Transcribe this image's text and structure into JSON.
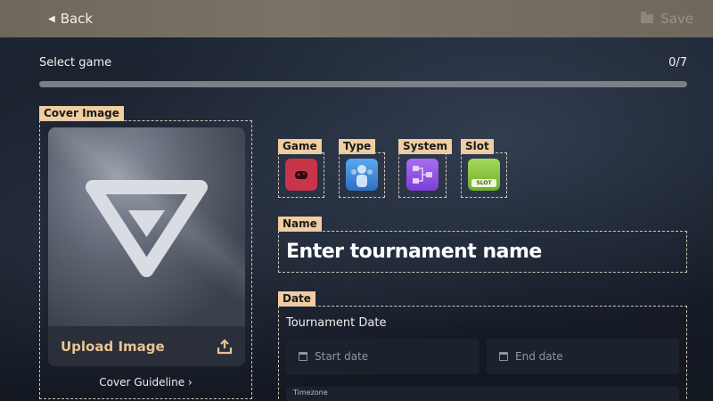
{
  "header": {
    "back_label": "Back",
    "save_label": "Save"
  },
  "progress": {
    "step_label": "Select game",
    "count": "0/7",
    "fraction": 0
  },
  "cover": {
    "tag": "Cover Image",
    "upload_label": "Upload Image",
    "guideline": "Cover Guideline ›"
  },
  "categories": [
    {
      "label": "Game",
      "icon": "gamepad-icon",
      "color": "#c8344a"
    },
    {
      "label": "Type",
      "icon": "people-icon",
      "color": "#3f8fe0"
    },
    {
      "label": "System",
      "icon": "bracket-icon",
      "color": "#9b55e6"
    },
    {
      "label": "Slot",
      "icon": "slot-icon",
      "color": "#8cc63f",
      "badge": "SLOT"
    }
  ],
  "name": {
    "tag": "Name",
    "placeholder": "Enter tournament name"
  },
  "date": {
    "tag": "Date",
    "title": "Tournament Date",
    "start_placeholder": "Start date",
    "end_placeholder": "End date",
    "timezone_label": "Timezone"
  }
}
